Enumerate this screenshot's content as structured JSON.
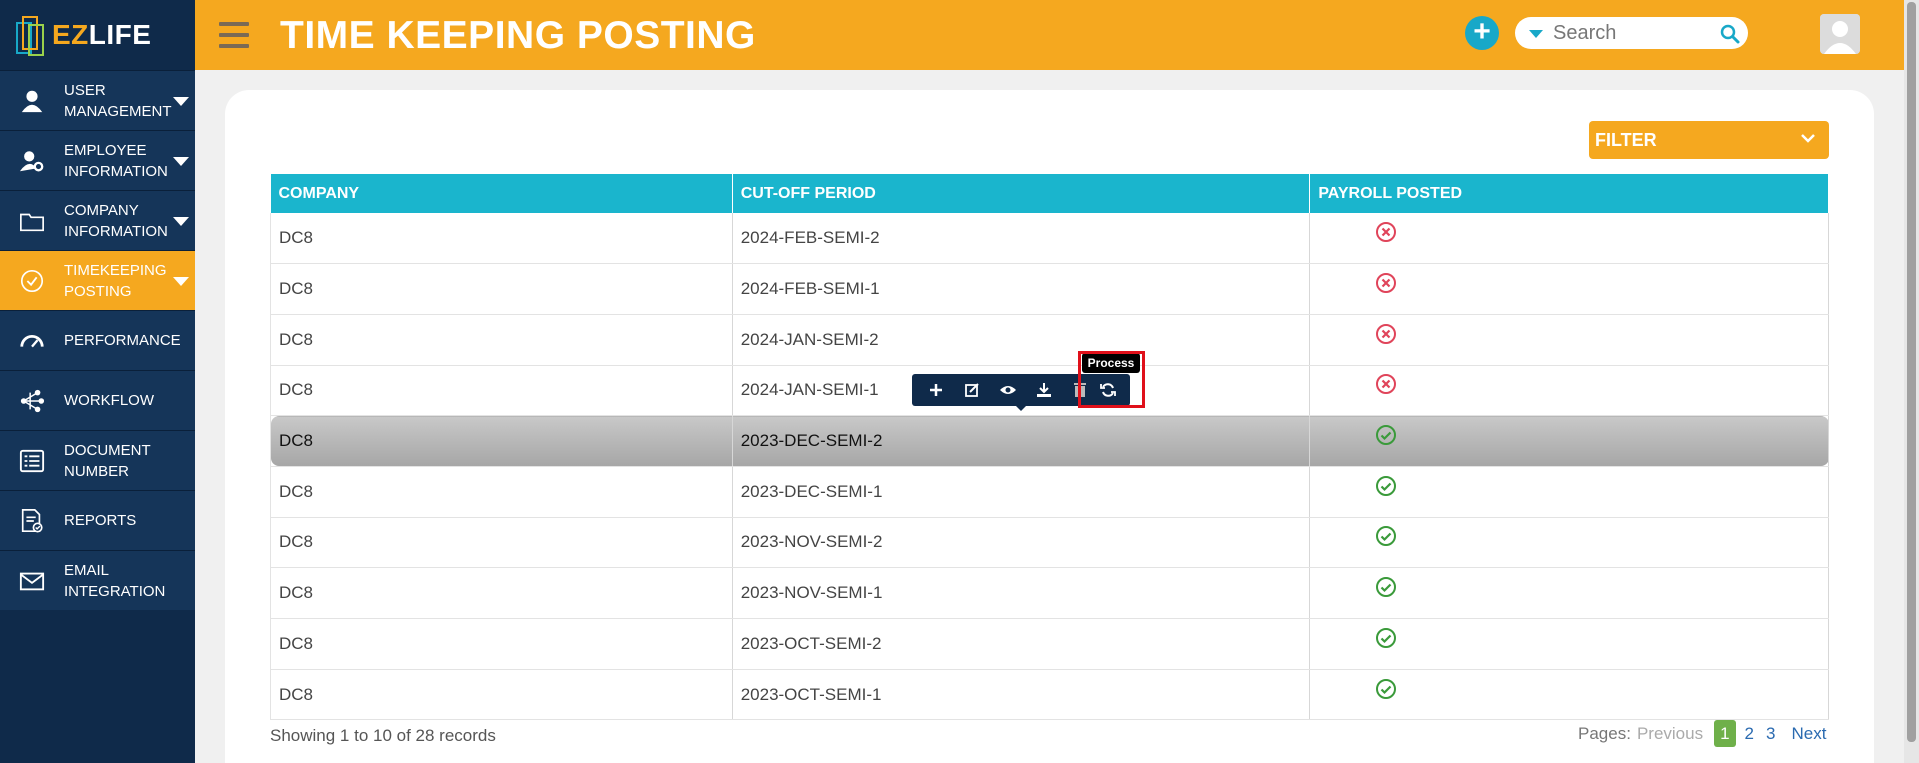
{
  "app": {
    "brand_ez": "EZ",
    "brand_life": "LIFE"
  },
  "header": {
    "title": "TIME KEEPING POSTING",
    "search_placeholder": "Search"
  },
  "sidebar": {
    "items": [
      {
        "label": "USER MANAGEMENT",
        "icon": "user-icon",
        "has_caret": true,
        "active": false
      },
      {
        "label": "EMPLOYEE INFORMATION",
        "icon": "user-gear-icon",
        "has_caret": true,
        "active": false
      },
      {
        "label": "COMPANY INFORMATION",
        "icon": "folder-icon",
        "has_caret": true,
        "active": false
      },
      {
        "label": "TIMEKEEPING POSTING",
        "icon": "check-circle-icon",
        "has_caret": true,
        "active": true
      },
      {
        "label": "PERFORMANCE",
        "icon": "gauge-icon",
        "has_caret": false,
        "active": false
      },
      {
        "label": "WORKFLOW",
        "icon": "workflow-icon",
        "has_caret": false,
        "active": false
      },
      {
        "label": "DOCUMENT NUMBER",
        "icon": "list-icon",
        "has_caret": false,
        "active": false
      },
      {
        "label": "REPORTS",
        "icon": "report-icon",
        "has_caret": false,
        "active": false
      },
      {
        "label": "EMAIL INTEGRATION",
        "icon": "mail-icon",
        "has_caret": false,
        "active": false
      }
    ]
  },
  "filter": {
    "label": "FILTER"
  },
  "table": {
    "columns": [
      "COMPANY",
      "CUT-OFF PERIOD",
      "PAYROLL POSTED"
    ],
    "rows": [
      {
        "company": "DC8",
        "period": "2024-FEB-SEMI-2",
        "posted": false
      },
      {
        "company": "DC8",
        "period": "2024-FEB-SEMI-1",
        "posted": false
      },
      {
        "company": "DC8",
        "period": "2024-JAN-SEMI-2",
        "posted": false
      },
      {
        "company": "DC8",
        "period": "2024-JAN-SEMI-1",
        "posted": false
      },
      {
        "company": "DC8",
        "period": "2023-DEC-SEMI-2",
        "posted": true
      },
      {
        "company": "DC8",
        "period": "2023-DEC-SEMI-1",
        "posted": true
      },
      {
        "company": "DC8",
        "period": "2023-NOV-SEMI-2",
        "posted": true
      },
      {
        "company": "DC8",
        "period": "2023-NOV-SEMI-1",
        "posted": true
      },
      {
        "company": "DC8",
        "period": "2023-OCT-SEMI-2",
        "posted": true
      },
      {
        "company": "DC8",
        "period": "2023-OCT-SEMI-1",
        "posted": true
      }
    ],
    "selected_row": 4
  },
  "row_toolbar": {
    "buttons": [
      "add-icon",
      "edit-icon",
      "view-icon",
      "download-icon",
      "delete-icon",
      "process-icon"
    ],
    "tooltip": "Process"
  },
  "footer": {
    "info": "Showing 1 to 10 of 28 records",
    "pages_label": "Pages:",
    "previous": "Previous",
    "pages": [
      "1",
      "2",
      "3"
    ],
    "current_page": "1",
    "next": "Next"
  },
  "colors": {
    "accent": "#f5a81f",
    "sidebar": "#0f2a4a",
    "table_header": "#1ab5cd",
    "posted": "#3a9a3a",
    "not_posted": "#e0445a"
  }
}
